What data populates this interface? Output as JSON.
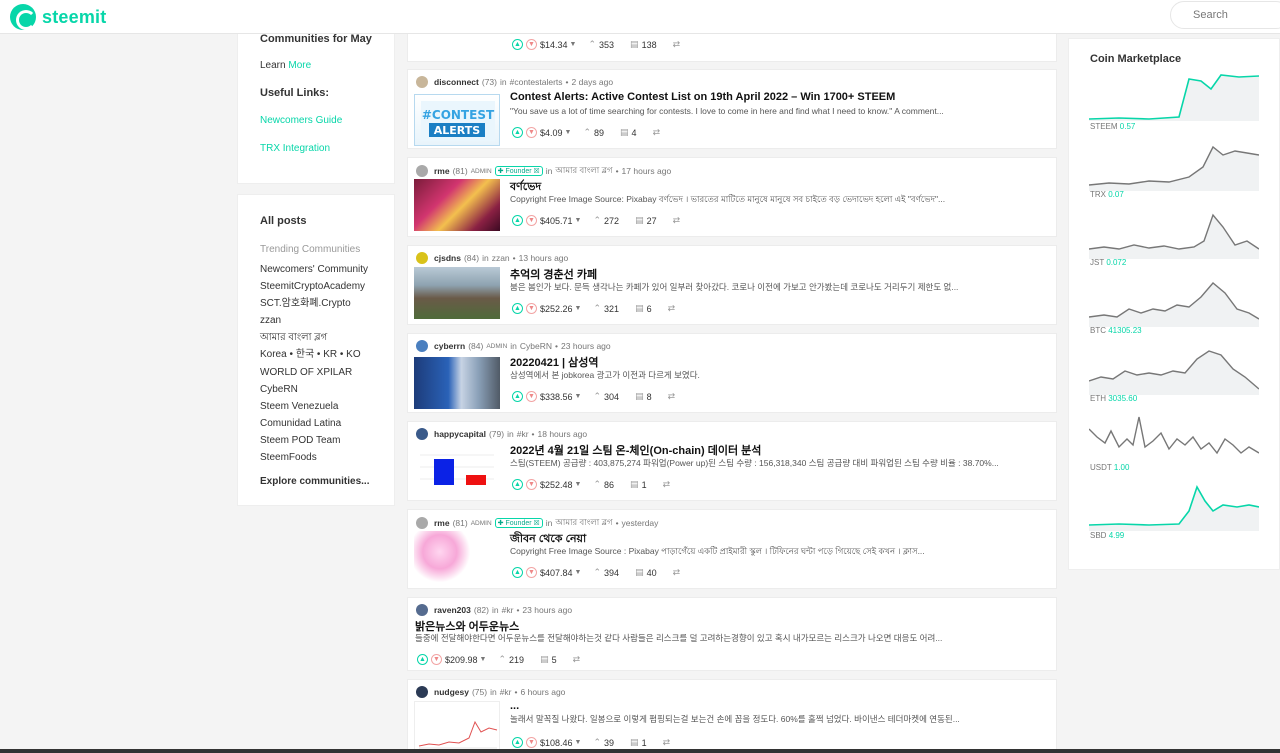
{
  "header": {
    "logo": "steemit",
    "search_placeholder": "Search"
  },
  "left": {
    "top_truncated": "Communities for May",
    "learn_prefix": "Learn",
    "learn_more": "More",
    "useful_links": "Useful Links:",
    "links": [
      "Newcomers Guide",
      "TRX Integration"
    ],
    "all_posts": "All posts",
    "trending": "Trending Communities",
    "communities": [
      "Newcomers' Community",
      "SteemitCryptoAcademy",
      "SCT.암호화폐.Crypto",
      "zzan",
      "আমার বাংলা ব্লগ",
      "Korea • 한국 • KR • KO",
      "WORLD OF XPILAR",
      "CybeRN",
      "Steem Venezuela",
      "Comunidad Latina",
      "Steem POD Team",
      "SteemFoods"
    ],
    "explore": "Explore communities..."
  },
  "posts": [
    {
      "payout": "$14.34",
      "resteems": "353",
      "comments": "138"
    },
    {
      "author": "disconnect",
      "rep": "(73)",
      "admin": "",
      "founder": "",
      "community": "#contestalerts",
      "time": "2 days ago",
      "title": "Contest Alerts: Active Contest List on 19th April 2022 – Win 1700+ STEEM",
      "excerpt": "\"You save us a lot of time searching for contests. I love to come in here and find what I need to know.\" A comment...",
      "payout": "$4.09",
      "resteems": "89",
      "comments": "4"
    },
    {
      "author": "rme",
      "rep": "(81)",
      "admin": "ADMIN",
      "founder": "Founder",
      "community": "আমার বাংলা ব্লগ",
      "time": "17 hours ago",
      "title": "বর্ণভেদ",
      "excerpt": "Copyright Free Image Source: Pixabay বর্ণভেদ । ভারতের মাটিতে মানুষে মানুষে সব চাইতে বড় ভেদাভেদ হলো এই \"বর্ণভেদ\"...",
      "payout": "$405.71",
      "resteems": "272",
      "comments": "27"
    },
    {
      "author": "cjsdns",
      "rep": "(84)",
      "admin": "",
      "founder": "",
      "community": "zzan",
      "time": "13 hours ago",
      "title": "추억의 경춘선 카페",
      "excerpt": "붐은 봄인가 보다. 문득 생각나는 카페가 있어 일부러 찾아갔다. 코로나 이전에 가보고 안가봤는데 코로나도 거리두기 제한도 없...",
      "payout": "$252.26",
      "resteems": "321",
      "comments": "6"
    },
    {
      "author": "cyberrn",
      "rep": "(84)",
      "admin": "ADMIN",
      "founder": "",
      "community": "CybeRN",
      "time": "23 hours ago",
      "title": "20220421 | 삼성역",
      "excerpt": "삼성역에서 본 jobkorea 광고가 이전과 다르게 보였다.",
      "payout": "$338.56",
      "resteems": "304",
      "comments": "8"
    },
    {
      "author": "happycapital",
      "rep": "(79)",
      "admin": "",
      "founder": "",
      "community": "#kr",
      "time": "18 hours ago",
      "title": "2022년 4월 21일 스팀 온-체인(On-chain) 데이터 분석",
      "excerpt": "스팀(STEEM) 공급량 : 403,875,274 파워업(Power up)된 스팀 수량 : 156,318,340 스팀 공급량 대비 파워업된 스팀 수량 비율 : 38.70%...",
      "payout": "$252.48",
      "resteems": "86",
      "comments": "1"
    },
    {
      "author": "rme",
      "rep": "(81)",
      "admin": "ADMIN",
      "founder": "Founder",
      "community": "আমার বাংলা ব্লগ",
      "time": "yesterday",
      "title": "জীবন থেকে নেয়া",
      "excerpt": "Copyright Free Image Source : Pixabay পাড়াগেঁয়ে একটি প্রাইমারী স্কুল । টিফিনের ঘন্টা পড়ে গিয়েছে সেই কখন । ক্লাস...",
      "payout": "$407.84",
      "resteems": "394",
      "comments": "40"
    },
    {
      "author": "raven203",
      "rep": "(82)",
      "admin": "",
      "founder": "",
      "community": "#kr",
      "time": "23 hours ago",
      "title": "밝은뉴스와 어두운뉴스",
      "excerpt": "들중에 전달해야한다면 어두운뉴스를 전달해야하는것 같다 사람들은 리스크를 덜 고려하는경향이 있고 혹시 내가모르는 리스크가 나오면 대응도 어려...",
      "payout": "$209.98",
      "resteems": "219",
      "comments": "5"
    },
    {
      "author": "nudgesy",
      "rep": "(75)",
      "admin": "",
      "founder": "",
      "community": "#kr",
      "time": "6 hours ago",
      "title": "...",
      "excerpt": "놀래서 말꼭질 나왔다. 일봉으로 이렇게 펌핑되는걸 보는건 손에 꼽을 정도다. 60%를 훌쩍 넘었다. 바이낸스 테더마켓에 연동된...",
      "payout": "$108.46",
      "resteems": "39",
      "comments": "1"
    }
  ],
  "market": {
    "title": "Coin Marketplace",
    "coins": [
      {
        "name": "STEEM",
        "value": "0.57"
      },
      {
        "name": "TRX",
        "value": "0.07"
      },
      {
        "name": "JST",
        "value": "0.072"
      },
      {
        "name": "BTC",
        "value": "41305.23"
      },
      {
        "name": "ETH",
        "value": "3035.60"
      },
      {
        "name": "USDT",
        "value": "1.00"
      },
      {
        "name": "SBD",
        "value": "4.99"
      }
    ]
  },
  "colors": {
    "accent": "#07d6a9",
    "border": "#eeeeee",
    "background": "#f4f4f4"
  }
}
